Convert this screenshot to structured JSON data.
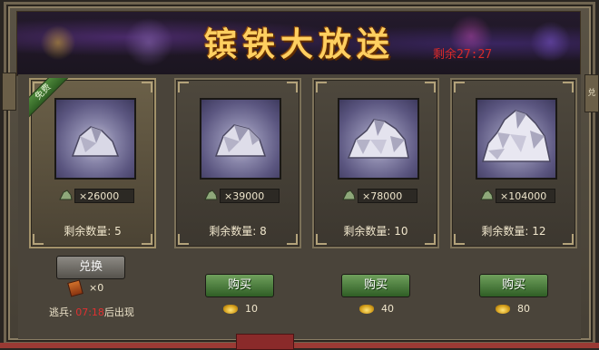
{
  "title": "镔铁大放送",
  "timer": "剩余27:27",
  "side_tab": "兑",
  "free_badge": "免费",
  "cards": [
    {
      "amount": "×26000",
      "remaining": "剩余数量: 5"
    },
    {
      "amount": "×39000",
      "remaining": "剩余数量: 8"
    },
    {
      "amount": "×78000",
      "remaining": "剩余数量: 10"
    },
    {
      "amount": "×104000",
      "remaining": "剩余数量: 12"
    }
  ],
  "exchange": {
    "button_label": "兑换",
    "token_count": "×0",
    "deserter_label": "逃兵:",
    "deserter_time": "07:18",
    "deserter_suffix": "后出现"
  },
  "buy_buttons": [
    {
      "label": "购买",
      "price": "10"
    },
    {
      "label": "购买",
      "price": "40"
    },
    {
      "label": "购买",
      "price": "80"
    }
  ],
  "colors": {
    "title_gold": "#ffcf60",
    "timer_red": "#d82a2a",
    "buy_green": "#4f8a3c",
    "deserter_red": "#e03030"
  },
  "icons": [
    "ore-icon",
    "gold-ingot-icon",
    "exchange-token-icon"
  ]
}
